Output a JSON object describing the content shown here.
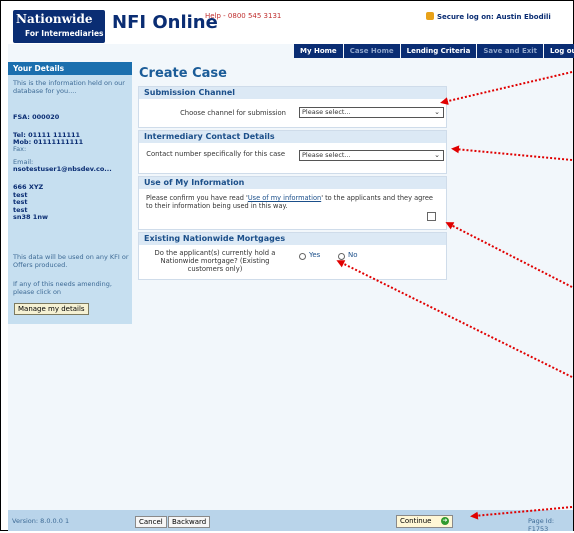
{
  "header": {
    "logo_brand": "Nationwide",
    "logo_sub": "For Intermediaries",
    "app_title": "NFI Online",
    "help": "Help - 0800 545 3131",
    "secure_login": "Secure log on: Austin Ebodili"
  },
  "nav": [
    {
      "label": "My Home",
      "active": true
    },
    {
      "label": "Case Home",
      "active": false
    },
    {
      "label": "Lending Criteria",
      "active": true
    },
    {
      "label": "Save and Exit",
      "active": false
    },
    {
      "label": "Log out",
      "active": true
    }
  ],
  "sidebar": {
    "title": "Your Details",
    "intro": "This is the information held on our database for you....",
    "fsa": "FSA: 000020",
    "tel": "Tel: 01111 111111",
    "mob": "Mob: 01111111111",
    "fax": "Fax:",
    "email_label": "Email:",
    "email": "nsotestuser1@nbsdev.co...",
    "address": [
      "666 XYZ",
      "test",
      "test",
      "test",
      "sn38 1nw"
    ],
    "note1": "This data will be used on any KFI or Offers produced.",
    "note2": "If any of this needs amending, please click on",
    "manage_button": "Manage my details"
  },
  "main": {
    "title": "Create Case",
    "submission_channel": {
      "heading": "Submission Channel",
      "label": "Choose channel for submission",
      "value": "Please select..."
    },
    "intermediary_contact": {
      "heading": "Intermediary Contact Details",
      "label": "Contact number specifically for this case",
      "value": "Please select..."
    },
    "use_of_info": {
      "heading": "Use of My Information",
      "text_before": "Please confirm you have read '",
      "link": "Use of my information",
      "text_after": "' to the applicants and they agree to their information being used in this way."
    },
    "existing_mortgages": {
      "heading": "Existing Nationwide Mortgages",
      "question": "Do the applicant(s) currently hold a Nationwide mortgage? (Existing customers only)",
      "yes": "Yes",
      "no": "No"
    }
  },
  "footer": {
    "version": "Version: 8.0.0.0 1",
    "cancel": "Cancel",
    "backward": "Backward",
    "continue": "Continue",
    "page_id": "Page Id: F1753"
  },
  "colors": {
    "brand_navy": "#0a2d73",
    "sidebar_bg": "#c6dff0",
    "panel_header": "#dce9f5",
    "annotation_red": "#e00000"
  }
}
